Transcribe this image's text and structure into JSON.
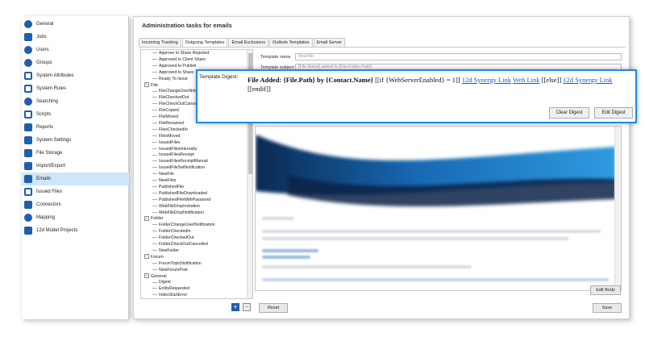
{
  "nav": {
    "items": [
      {
        "label": "General",
        "icon": "gauge-icon"
      },
      {
        "label": "Jobs",
        "icon": "briefcase-icon"
      },
      {
        "label": "Users",
        "icon": "user-icon"
      },
      {
        "label": "Groups",
        "icon": "groups-icon"
      },
      {
        "label": "System Attributes",
        "icon": "attributes-icon"
      },
      {
        "label": "System Rules",
        "icon": "rules-icon"
      },
      {
        "label": "Searching",
        "icon": "search-icon"
      },
      {
        "label": "Scripts",
        "icon": "code-icon"
      },
      {
        "label": "Reports",
        "icon": "reports-icon"
      },
      {
        "label": "System Settings",
        "icon": "settings-icon"
      },
      {
        "label": "File Storage",
        "icon": "storage-icon"
      },
      {
        "label": "Import/Export",
        "icon": "import-export-icon"
      },
      {
        "label": "Emails",
        "icon": "email-icon"
      },
      {
        "label": "Issued Files",
        "icon": "issued-files-icon"
      },
      {
        "label": "Connectors",
        "icon": "connectors-icon"
      },
      {
        "label": "Mapping",
        "icon": "globe-icon"
      },
      {
        "label": "12d Model Projects",
        "icon": "project-icon"
      }
    ],
    "active": "Emails"
  },
  "main": {
    "title": "Administration tasks for emails",
    "tabs": [
      "Incoming Tracking",
      "Outgoing Templates",
      "Email Exclusions",
      "Outlook Templates",
      "Email Server"
    ],
    "active_tab": "Outgoing Templates"
  },
  "tree": {
    "rows": [
      {
        "text": "Approve to Share Rejected",
        "cat": false
      },
      {
        "text": "Approved to Client Share",
        "cat": false
      },
      {
        "text": "Approved to Publish",
        "cat": false
      },
      {
        "text": "Approved to Share",
        "cat": false
      },
      {
        "text": "Ready To Issue",
        "cat": false
      },
      {
        "text": "File",
        "cat": true
      },
      {
        "text": "FileChangeUserNotif",
        "cat": false
      },
      {
        "text": "FileCheckedOut",
        "cat": false
      },
      {
        "text": "FileCheckOutCancell",
        "cat": false
      },
      {
        "text": "FileCopied",
        "cat": false
      },
      {
        "text": "FileMoved",
        "cat": false
      },
      {
        "text": "FileRenamed",
        "cat": false
      },
      {
        "text": "FilesCheckedIn",
        "cat": false
      },
      {
        "text": "FilesMoved",
        "cat": false
      },
      {
        "text": "IssuedFiles",
        "cat": false
      },
      {
        "text": "IssuedFilesInternally",
        "cat": false
      },
      {
        "text": "IssuedFilesReceipt",
        "cat": false
      },
      {
        "text": "IssuedFilesReceiptManual",
        "cat": false
      },
      {
        "text": "IssuedFileSetNotification",
        "cat": false
      },
      {
        "text": "NewFile",
        "cat": false
      },
      {
        "text": "NewFiles",
        "cat": false
      },
      {
        "text": "PublishedFile",
        "cat": false
      },
      {
        "text": "PublishedFileDownloaded",
        "cat": false
      },
      {
        "text": "PublishedFileWithPassword",
        "cat": false
      },
      {
        "text": "WebFileDropInvitation",
        "cat": false
      },
      {
        "text": "WebFileDropNotification",
        "cat": false
      },
      {
        "text": "Folder",
        "cat": true
      },
      {
        "text": "FolderChangeUserNotification",
        "cat": false
      },
      {
        "text": "FolderCheckedIn",
        "cat": false
      },
      {
        "text": "FolderCheckedOut",
        "cat": false
      },
      {
        "text": "FolderCheckOutCancelled",
        "cat": false
      },
      {
        "text": "NewFolder",
        "cat": false
      },
      {
        "text": "Forum",
        "cat": true
      },
      {
        "text": "ForumTopicNotification",
        "cat": false
      },
      {
        "text": "NewForumPost",
        "cat": false
      },
      {
        "text": "General",
        "cat": true
      },
      {
        "text": "Digest",
        "cat": false
      },
      {
        "text": "EntityRequested",
        "cat": false
      },
      {
        "text": "IndexStartError",
        "cat": false
      }
    ],
    "add_symbol": "+",
    "remove_symbol": "−"
  },
  "form": {
    "name_label": "Template name",
    "name_value": "NewFile",
    "subject_label": "Template subject",
    "subject_value": "[File.Name] added to [File.Folder.Path]"
  },
  "digest": {
    "label": "Template Digest:",
    "bold_text": "File Added: {File.Path} by {Contact.Name}",
    "text_if": " [[if {WebServerEnabled} = 1]] ",
    "link1": "12d Synergy Link",
    "link2": "Web Link",
    "text_else": " [[else]] ",
    "link3": "12d Synergy Link",
    "text_endif": " [[endif]]",
    "clear_button": "Clear Digest",
    "edit_button": "Edit Digest"
  },
  "buttons": {
    "edit_body": "Edit Body",
    "reset": "Reset",
    "save": "Save"
  },
  "colors": {
    "accent": "#1a8ae6",
    "nav_active": "#cfe6f9",
    "icon_blue": "#1f5fa8"
  }
}
